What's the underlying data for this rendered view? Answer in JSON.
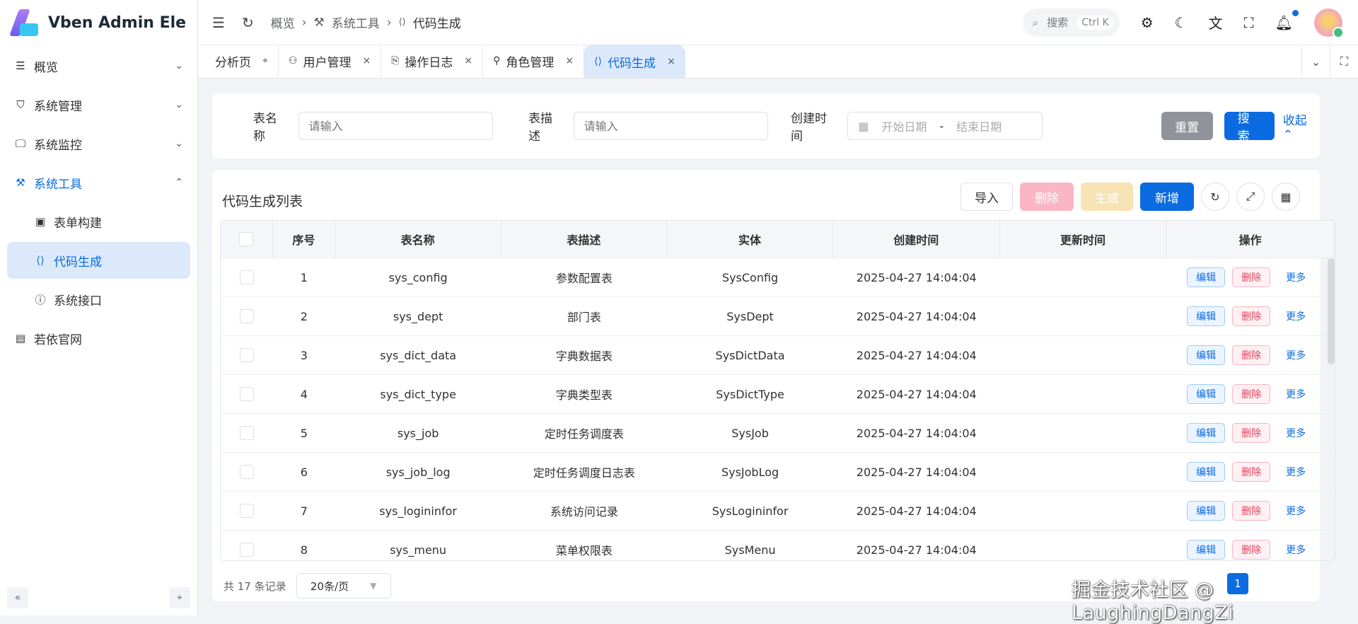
{
  "app": {
    "title": "Vben Admin Ele"
  },
  "sidebar": {
    "items": [
      {
        "label": "概览",
        "icon": "menu-icon",
        "glyph": "☰",
        "chev": "⌄"
      },
      {
        "label": "系统管理",
        "icon": "shield-icon",
        "glyph": "⛉",
        "chev": "⌄"
      },
      {
        "label": "系统监控",
        "icon": "monitor-icon",
        "glyph": "🖵",
        "chev": "⌄"
      },
      {
        "label": "系统工具",
        "icon": "tool-icon",
        "glyph": "⚒",
        "chev": "⌃",
        "open": true
      },
      {
        "label": "表单构建",
        "icon": "form-icon",
        "glyph": "▣",
        "sub": true
      },
      {
        "label": "代码生成",
        "icon": "code-icon",
        "glyph": "⟨⟩",
        "sub": true,
        "active": true
      },
      {
        "label": "系统接口",
        "icon": "api-icon",
        "glyph": "ⓘ",
        "sub": true
      },
      {
        "label": "若依官网",
        "icon": "window-icon",
        "glyph": "▤"
      }
    ]
  },
  "header": {
    "breadcrumb": [
      "概览",
      "系统工具",
      "代码生成"
    ],
    "search_label": "搜索",
    "search_kbd": "Ctrl K"
  },
  "tabs": [
    {
      "label": "分析页",
      "close": "⌖"
    },
    {
      "label": "用户管理",
      "close": "×"
    },
    {
      "label": "操作日志",
      "close": "×"
    },
    {
      "label": "角色管理",
      "close": "×"
    },
    {
      "label": "代码生成",
      "close": "×",
      "active": true
    }
  ],
  "search": {
    "table_name_label": "表名称",
    "table_name_placeholder": "请输入",
    "table_desc_label": "表描述",
    "table_desc_placeholder": "请输入",
    "created_label": "创建时间",
    "start_placeholder": "开始日期",
    "range_sep": "-",
    "end_placeholder": "结束日期",
    "reset": "重置",
    "search": "搜索",
    "collapse": "收起"
  },
  "list": {
    "title": "代码生成列表",
    "import": "导入",
    "delete": "删除",
    "generate": "生成",
    "add": "新增"
  },
  "table": {
    "columns": [
      "",
      "序号",
      "表名称",
      "表描述",
      "实体",
      "创建时间",
      "更新时间",
      "操作"
    ],
    "rows": [
      [
        "1",
        "sys_config",
        "参数配置表",
        "SysConfig",
        "2025-04-27 14:04:04",
        ""
      ],
      [
        "2",
        "sys_dept",
        "部门表",
        "SysDept",
        "2025-04-27 14:04:04",
        ""
      ],
      [
        "3",
        "sys_dict_data",
        "字典数据表",
        "SysDictData",
        "2025-04-27 14:04:04",
        ""
      ],
      [
        "4",
        "sys_dict_type",
        "字典类型表",
        "SysDictType",
        "2025-04-27 14:04:04",
        ""
      ],
      [
        "5",
        "sys_job",
        "定时任务调度表",
        "SysJob",
        "2025-04-27 14:04:04",
        ""
      ],
      [
        "6",
        "sys_job_log",
        "定时任务调度日志表",
        "SysJobLog",
        "2025-04-27 14:04:04",
        ""
      ],
      [
        "7",
        "sys_logininfor",
        "系统访问记录",
        "SysLogininfor",
        "2025-04-27 14:04:04",
        ""
      ],
      [
        "8",
        "sys_menu",
        "菜单权限表",
        "SysMenu",
        "2025-04-27 14:04:04",
        ""
      ]
    ],
    "actions": {
      "edit": "编辑",
      "delete": "删除",
      "more": "更多"
    }
  },
  "pagination": {
    "total": "共 17 条记录",
    "page_size": "20条/页",
    "current_page": "1"
  },
  "watermark": "掘金技术社区 @ LaughingDangZi",
  "colors": {
    "primary": "#0b6be0",
    "danger": "#e8415c"
  }
}
